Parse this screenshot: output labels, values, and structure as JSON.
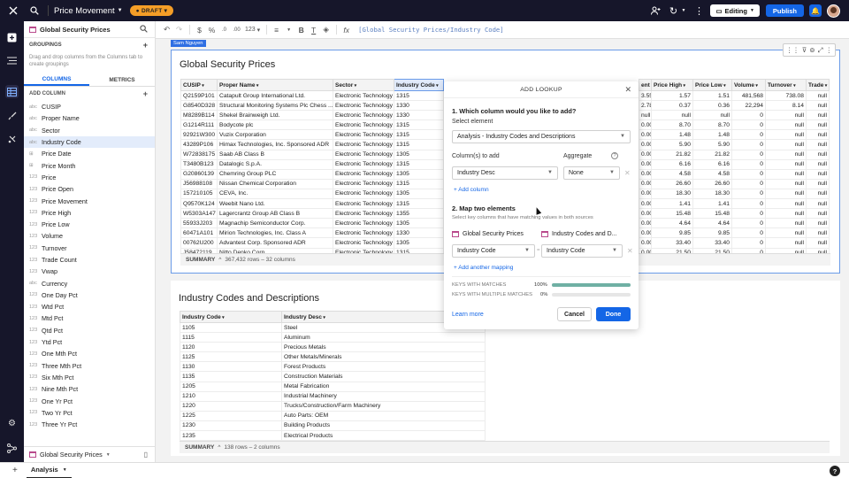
{
  "topbar": {
    "page_title": "Price Movement",
    "draft_label": "DRAFT",
    "editing_label": "Editing",
    "publish_label": "Publish"
  },
  "sidebar": {
    "source_name": "Global Security Prices",
    "groupings_label": "GROUPINGS",
    "groupings_hint": "Drag and drop columns from the Columns tab to create groupings",
    "tabs": [
      "COLUMNS",
      "METRICS"
    ],
    "add_column_label": "ADD COLUMN",
    "columns": [
      {
        "type": "abc",
        "name": "CUSIP"
      },
      {
        "type": "abc",
        "name": "Proper Name"
      },
      {
        "type": "abc",
        "name": "Sector"
      },
      {
        "type": "abc",
        "name": "Industry Code",
        "selected": true
      },
      {
        "type": "⊞",
        "name": "Price Date"
      },
      {
        "type": "⊞",
        "name": "Price Month"
      },
      {
        "type": "123",
        "name": "Price"
      },
      {
        "type": "123",
        "name": "Price Open"
      },
      {
        "type": "123",
        "name": "Price Movement"
      },
      {
        "type": "123",
        "name": "Price High"
      },
      {
        "type": "123",
        "name": "Price Low"
      },
      {
        "type": "123",
        "name": "Volume"
      },
      {
        "type": "123",
        "name": "Turnover"
      },
      {
        "type": "123",
        "name": "Trade Count"
      },
      {
        "type": "123",
        "name": "Vwap"
      },
      {
        "type": "abc",
        "name": "Currency"
      },
      {
        "type": "123",
        "name": "One Day Pct"
      },
      {
        "type": "123",
        "name": "Wtd Pct"
      },
      {
        "type": "123",
        "name": "Mtd Pct"
      },
      {
        "type": "123",
        "name": "Qtd Pct"
      },
      {
        "type": "123",
        "name": "Ytd Pct"
      },
      {
        "type": "123",
        "name": "One Mth Pct"
      },
      {
        "type": "123",
        "name": "Three Mth Pct"
      },
      {
        "type": "123",
        "name": "Six Mth Pct"
      },
      {
        "type": "123",
        "name": "Nine Mth Pct"
      },
      {
        "type": "123",
        "name": "One Yr Pct"
      },
      {
        "type": "123",
        "name": "Two Yr Pct"
      },
      {
        "type": "123",
        "name": "Three Yr Pct"
      }
    ],
    "footer_source": "Global Security Prices"
  },
  "toolbar": {
    "formula": "[Global Security Prices/Industry Code]",
    "number_format": "123"
  },
  "element1": {
    "user_tag": "Sam Nguyen",
    "title": "Global Security Prices",
    "headers_left": [
      "CUSIP",
      "Proper Name",
      "Sector",
      "Industry Code"
    ],
    "headers_right": [
      "ent",
      "Price High",
      "Price Low",
      "Volume",
      "Turnover",
      "Trade"
    ],
    "rows_left": [
      [
        "Q2159P101",
        "Catapult Group International Ltd.",
        "Electronic Technology",
        "1315"
      ],
      [
        "G8540D328",
        "Structural Monitoring Systems Plc Chess ...",
        "Electronic Technology",
        "1330"
      ],
      [
        "M8289B114",
        "Shekel Brainweigh Ltd.",
        "Electronic Technology",
        "1330"
      ],
      [
        "G1214R111",
        "Bodycote plc",
        "Electronic Technology",
        "1315"
      ],
      [
        "92921W300",
        "Vuzix Corporation",
        "Electronic Technology",
        "1315"
      ],
      [
        "43289P106",
        "Himax Technologies, Inc. Sponsored ADR",
        "Electronic Technology",
        "1315"
      ],
      [
        "W72838175",
        "Saab AB Class B",
        "Electronic Technology",
        "1305"
      ],
      [
        "T3480B123",
        "Datalogic S.p.A.",
        "Electronic Technology",
        "1315"
      ],
      [
        "G20860139",
        "Chemring Group PLC",
        "Electronic Technology",
        "1305"
      ],
      [
        "J56988108",
        "Nissan Chemical Corporation",
        "Electronic Technology",
        "1315"
      ],
      [
        "157210105",
        "CEVA, Inc.",
        "Electronic Technology",
        "1305"
      ],
      [
        "Q9570K124",
        "Weebit Nano Ltd.",
        "Electronic Technology",
        "1315"
      ],
      [
        "W5303A147",
        "Lagercrantz Group AB Class B",
        "Electronic Technology",
        "1355"
      ],
      [
        "55933J203",
        "Magnachip Semiconductor Corp.",
        "Electronic Technology",
        "1305"
      ],
      [
        "60471A101",
        "Mirion Technologies, Inc. Class A",
        "Electronic Technology",
        "1330"
      ],
      [
        "00762U200",
        "Advantest Corp. Sponsored ADR",
        "Electronic Technology",
        "1305"
      ],
      [
        "J58472119",
        "Nitto Denko Corp.",
        "Electronic Technology",
        "1315"
      ]
    ],
    "rows_right": [
      [
        "3.55%",
        "1.57",
        "1.51",
        "481,568",
        "738.08",
        "null"
      ],
      [
        "2.78%",
        "0.37",
        "0.36",
        "22,294",
        "8.14",
        "null"
      ],
      [
        "null",
        "null",
        "null",
        "0",
        "null",
        "null"
      ],
      [
        "0.00%",
        "8.70",
        "8.70",
        "0",
        "null",
        "null"
      ],
      [
        "0.00%",
        "1.48",
        "1.48",
        "0",
        "null",
        "null"
      ],
      [
        "0.00%",
        "5.90",
        "5.90",
        "0",
        "null",
        "null"
      ],
      [
        "0.00%",
        "21.82",
        "21.82",
        "0",
        "null",
        "null"
      ],
      [
        "0.00%",
        "6.16",
        "6.16",
        "0",
        "null",
        "null"
      ],
      [
        "0.00%",
        "4.58",
        "4.58",
        "0",
        "null",
        "null"
      ],
      [
        "0.00%",
        "26.60",
        "26.60",
        "0",
        "null",
        "null"
      ],
      [
        "0.00%",
        "18.30",
        "18.30",
        "0",
        "null",
        "null"
      ],
      [
        "0.00%",
        "1.41",
        "1.41",
        "0",
        "null",
        "null"
      ],
      [
        "0.00%",
        "15.48",
        "15.48",
        "0",
        "null",
        "null"
      ],
      [
        "0.00%",
        "4.64",
        "4.64",
        "0",
        "null",
        "null"
      ],
      [
        "0.00%",
        "9.85",
        "9.85",
        "0",
        "null",
        "null"
      ],
      [
        "0.00%",
        "33.40",
        "33.40",
        "0",
        "null",
        "null"
      ],
      [
        "0.00%",
        "21.50",
        "21.50",
        "0",
        "null",
        "null"
      ]
    ],
    "summary_label": "SUMMARY",
    "summary_text": "367,432 rows – 32 columns"
  },
  "element2": {
    "title": "Industry Codes and Descriptions",
    "headers": [
      "Industry Code",
      "Industry Desc"
    ],
    "rows": [
      [
        "1105",
        "Steel"
      ],
      [
        "1115",
        "Aluminum"
      ],
      [
        "1120",
        "Precious Metals"
      ],
      [
        "1125",
        "Other Metals/Minerals"
      ],
      [
        "1130",
        "Forest Products"
      ],
      [
        "1135",
        "Construction Materials"
      ],
      [
        "1205",
        "Metal Fabrication"
      ],
      [
        "1210",
        "Industrial Machinery"
      ],
      [
        "1220",
        "Trucks/Construction/Farm Machinery"
      ],
      [
        "1225",
        "Auto Parts: OEM"
      ],
      [
        "1230",
        "Building Products"
      ],
      [
        "1235",
        "Electrical Products"
      ]
    ],
    "summary_label": "SUMMARY",
    "summary_text": "138 rows – 2 columns"
  },
  "lookup": {
    "title": "ADD LOOKUP",
    "q1": "1. Which column would you like to add?",
    "select_element_label": "Select element",
    "select_element_value": "Analysis - Industry Codes and Descriptions",
    "columns_to_add_label": "Column(s) to add",
    "aggregate_label": "Aggregate",
    "column_value": "Industry Desc",
    "aggregate_value": "None",
    "add_column_link": "+ Add column",
    "q2": "2. Map two elements",
    "q2_hint": "Select key columns that have matching values in both sources",
    "source_left": "Global Security Prices",
    "source_right": "Industry Codes and D...",
    "key_left": "Industry Code",
    "key_right": "Industry Code",
    "add_mapping_link": "+ Add another mapping",
    "keys_with_matches_label": "KEYS WITH MATCHES",
    "keys_with_matches_pct": "100%",
    "keys_with_matches_value": 1.0,
    "keys_multiple_label": "KEYS WITH MULTIPLE MATCHES",
    "keys_multiple_pct": "0%",
    "keys_multiple_value": 0.0,
    "learn_more": "Learn more",
    "cancel_label": "Cancel",
    "done_label": "Done"
  },
  "bottombar": {
    "tab_label": "Analysis",
    "help_label": "?"
  }
}
